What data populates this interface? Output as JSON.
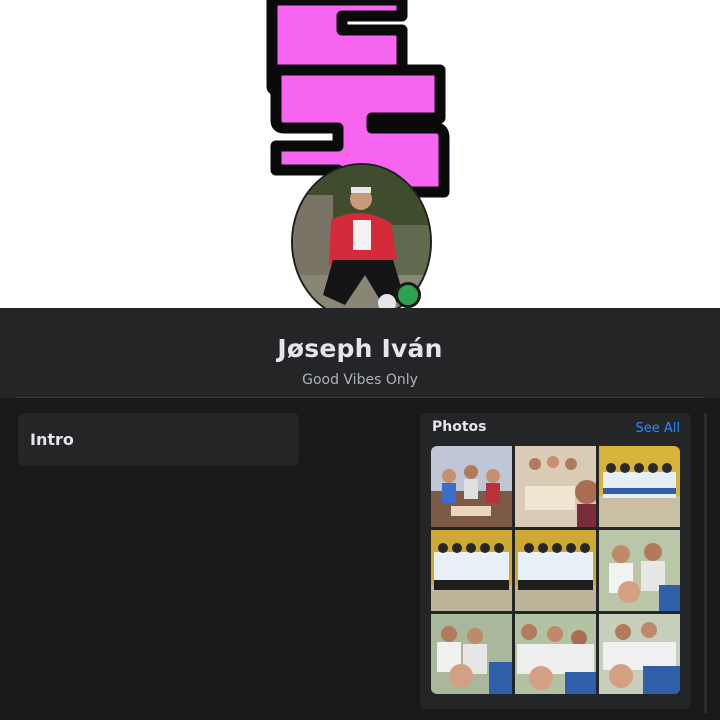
{
  "profile": {
    "name": "Jøseph Iván",
    "bio": "Good Vibes Only",
    "online": true
  },
  "intro": {
    "title": "Intro"
  },
  "photos": {
    "title": "Photos",
    "see_all_label": "See All",
    "count": 9
  },
  "colors": {
    "background": "#18191a",
    "card": "#242526",
    "cover_accent": "#f565f0",
    "link": "#2d88ff",
    "online": "#31a24c"
  }
}
